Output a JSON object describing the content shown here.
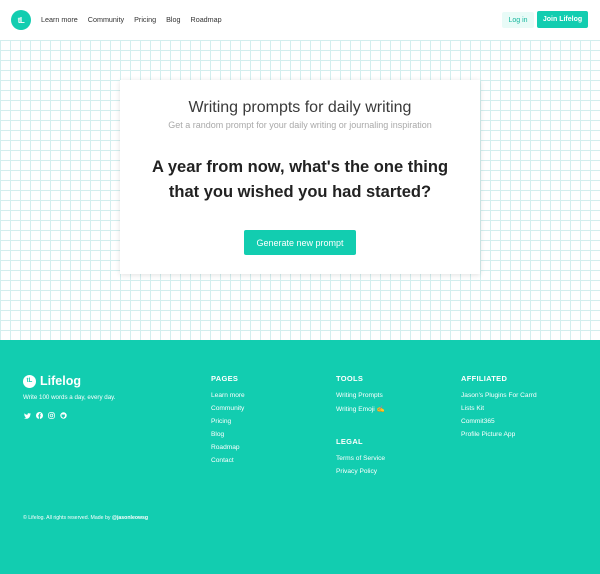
{
  "header": {
    "logo_text": "tL",
    "nav": [
      "Learn more",
      "Community",
      "Pricing",
      "Blog",
      "Roadmap"
    ],
    "login": "Log in",
    "join": "Join Lifelog"
  },
  "card": {
    "title": "Writing prompts for daily writing",
    "subtitle": "Get a random prompt for your daily writing or journaling inspiration",
    "prompt_line1": "A year from now, what's the one thing",
    "prompt_line2": "that you wished you had started?",
    "button": "Generate new prompt"
  },
  "footer": {
    "brand": "Lifelog",
    "logo_text": "tL",
    "tagline": "Write 100 words a day, every day.",
    "socials": [
      "twitter-icon",
      "facebook-icon",
      "instagram-icon",
      "github-icon"
    ],
    "pages": {
      "title": "PAGES",
      "items": [
        "Learn more",
        "Community",
        "Pricing",
        "Blog",
        "Roadmap",
        "Contact"
      ]
    },
    "tools": {
      "title": "TOOLS",
      "items": [
        "Writing Prompts",
        "Writing Emoji ✍️"
      ]
    },
    "legal": {
      "title": "LEGAL",
      "items": [
        "Terms of Service",
        "Privacy Policy"
      ]
    },
    "affiliated": {
      "title": "AFFILIATED",
      "items": [
        "Jason's Plugins For Carrd",
        "Lists Kit",
        "Commit365",
        "Profile Picture App"
      ]
    },
    "copyright": "© Lifelog. All rights reserved. Made by",
    "author": "@jasonleowsg"
  },
  "colors": {
    "accent": "#12cdb0",
    "grid": "#d3eeee"
  }
}
